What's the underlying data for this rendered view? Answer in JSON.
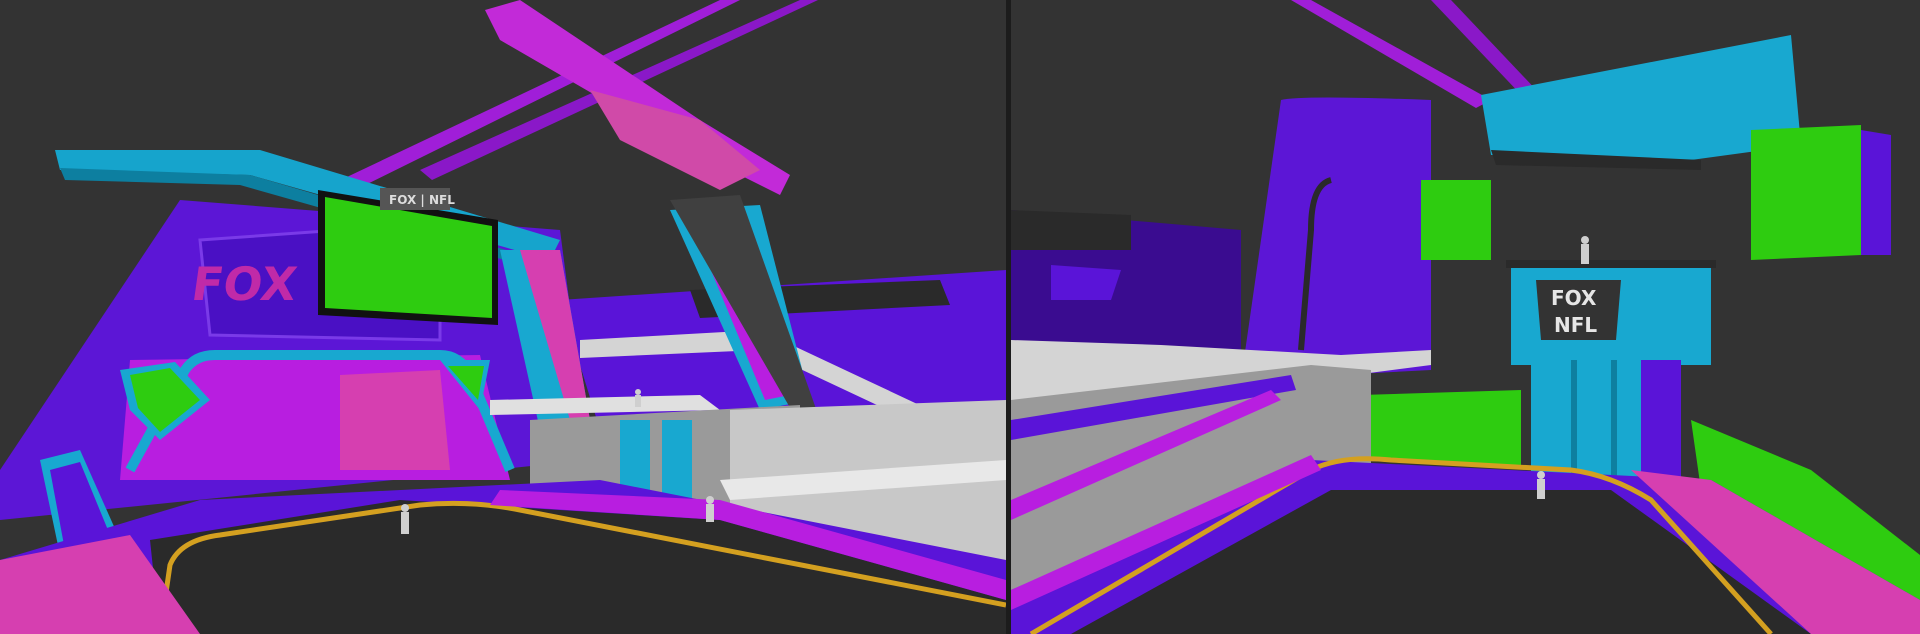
{
  "scene": {
    "left_viewport": {
      "backdrop_logo": "FOX",
      "scoreboard_logo": "FOX | NFL"
    },
    "right_viewport": {
      "desk_logo_top": "FOX",
      "desk_logo_bottom": "NFL"
    }
  },
  "colors": {
    "background": "#333333",
    "violet": "#5a14d8",
    "magenta": "#b41ee0",
    "pink": "#d63fb0",
    "cyan": "#14a8d0",
    "green": "#2ecc10",
    "floor": "#2a2a2a",
    "gold": "#d4a020",
    "grey": "#9a9a9a"
  }
}
